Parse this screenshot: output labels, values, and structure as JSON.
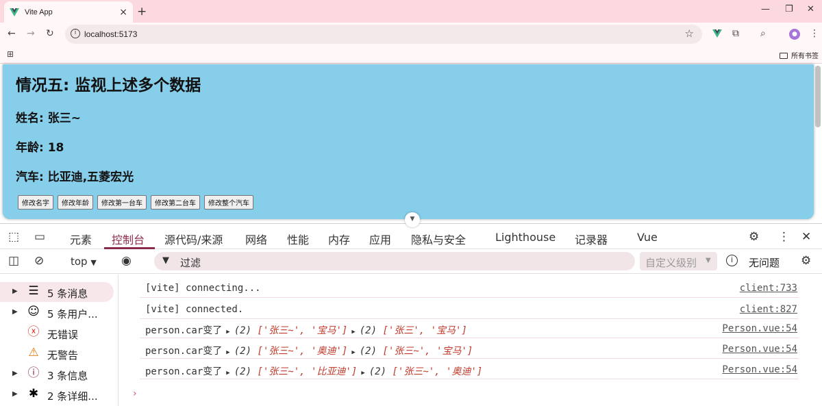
{
  "browser": {
    "tab_title": "Vite App",
    "tab_close": "×",
    "new_tab": "+",
    "url": "localhost:5173",
    "bookmarks_folder": "所有书签"
  },
  "page": {
    "heading": "情况五: 监视上述多个数据",
    "name_line": "姓名: 张三~",
    "age_line": "年龄: 18",
    "car_line": "汽车: 比亚迪,五菱宏光",
    "buttons": [
      "修改名字",
      "修改年龄",
      "修改第一台车",
      "修改第二台车",
      "修改整个汽车"
    ]
  },
  "devtools": {
    "tabs": [
      "元素",
      "控制台",
      "源代码/来源",
      "网络",
      "性能",
      "内存",
      "应用",
      "隐私与安全",
      "Lighthouse",
      "记录器",
      "Vue"
    ],
    "active_tab": "控制台",
    "context": "top",
    "filter_placeholder": "过滤",
    "levels": "自定义级别",
    "issues": "无问题",
    "sidebar": [
      {
        "label": "5 条消息",
        "icon": "list-icon"
      },
      {
        "label": "5 条用户...",
        "icon": "user-icon"
      },
      {
        "label": "无错误",
        "icon": "error-icon"
      },
      {
        "label": "无警告",
        "icon": "warning-icon"
      },
      {
        "label": "3 条信息",
        "icon": "info-icon"
      },
      {
        "label": "2 条详细...",
        "icon": "bug-icon"
      }
    ],
    "logs": [
      {
        "text": "[vite] connecting...",
        "source": "client:733"
      },
      {
        "text": "[vite] connected.",
        "source": "client:827"
      },
      {
        "prefix": "person.car变了",
        "a_count": "(2)",
        "a_items": "['张三~', '宝马']",
        "b_count": "(2)",
        "b_items": "['张三', '宝马']",
        "source": "Person.vue:54"
      },
      {
        "prefix": "person.car变了",
        "a_count": "(2)",
        "a_items": "['张三~', '奥迪']",
        "b_count": "(2)",
        "b_items": "['张三~', '宝马']",
        "source": "Person.vue:54"
      },
      {
        "prefix": "person.car变了",
        "a_count": "(2)",
        "a_items": "['张三~', '比亚迪']",
        "b_count": "(2)",
        "b_items": "['张三~', '奥迪']",
        "source": "Person.vue:54"
      }
    ],
    "prompt": "›"
  }
}
